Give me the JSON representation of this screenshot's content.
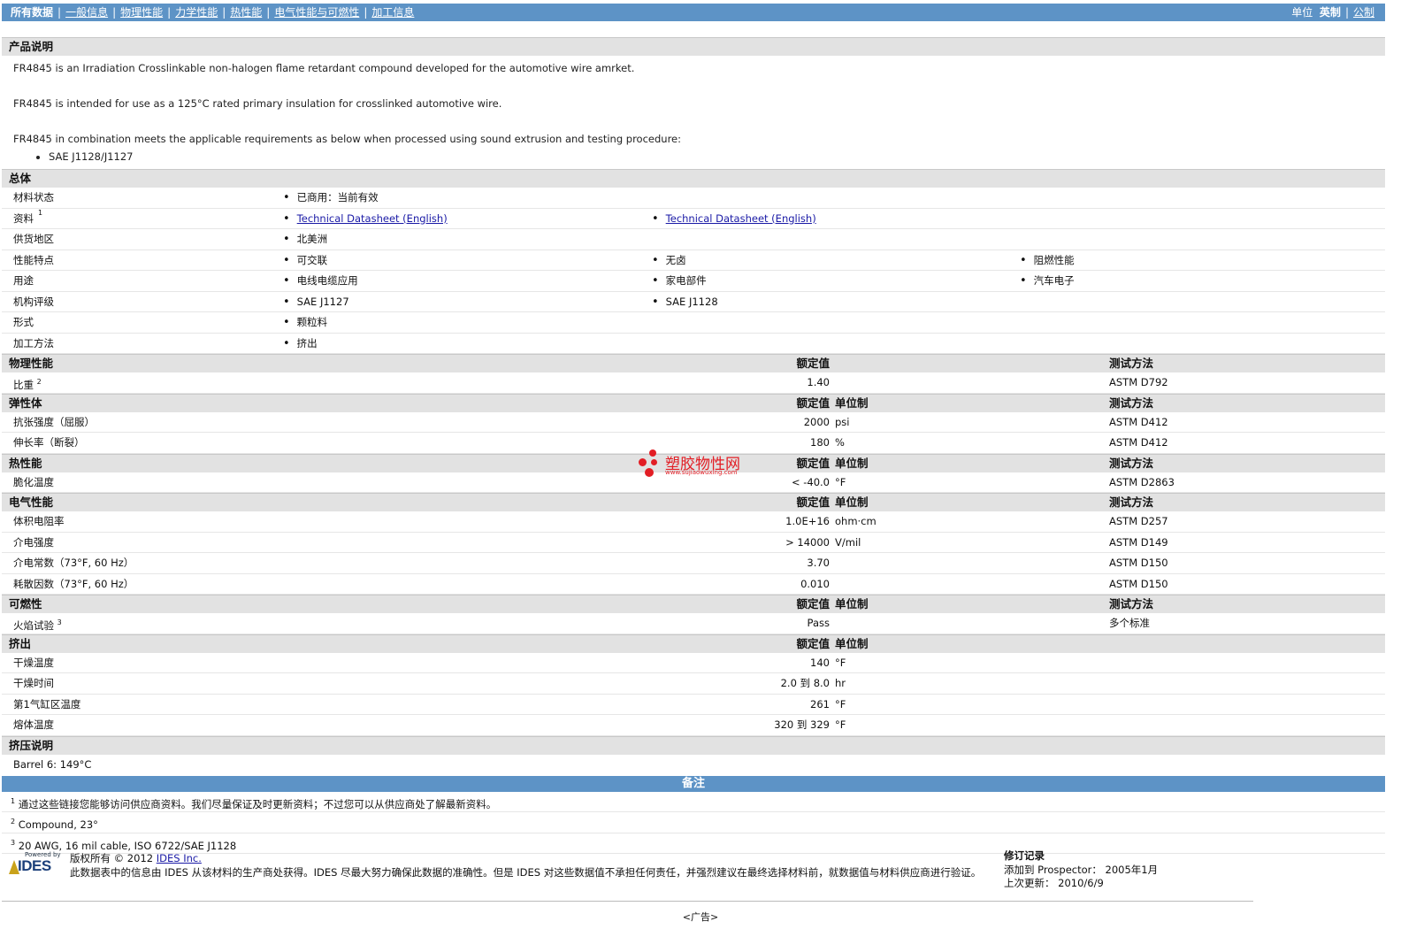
{
  "nav": {
    "items": [
      "所有数据",
      "一般信息",
      "物理性能",
      "力学性能",
      "热性能",
      "电气性能与可燃性",
      "加工信息"
    ],
    "units_label": "单位",
    "unit_english": "英制",
    "unit_metric": "公制"
  },
  "description": {
    "title": "产品说明",
    "p1": "FR4845 is an Irradiation Crosslinkable non-halogen flame retardant compound developed for the automotive wire amrket.",
    "p2": "FR4845 is intended for use as a 125°C rated primary insulation for crosslinked automotive wire.",
    "p3": "FR4845 in combination meets the applicable requirements as below when processed using sound extrusion and testing procedure:",
    "bullet": "SAE J1128/J1127"
  },
  "general": {
    "title": "总体",
    "rows": [
      {
        "label": "材料状态",
        "sup": "",
        "values": [
          "已商用：当前有效"
        ]
      },
      {
        "label": "资料",
        "sup": "1",
        "values": [
          "Technical Datasheet (English)",
          "Technical Datasheet (English)"
        ]
      },
      {
        "label": "供货地区",
        "sup": "",
        "values": [
          "北美洲"
        ]
      },
      {
        "label": "性能特点",
        "sup": "",
        "values": [
          "可交联",
          "无卤",
          "阻燃性能"
        ]
      },
      {
        "label": "用途",
        "sup": "",
        "values": [
          "电线电缆应用",
          "家电部件",
          "汽车电子"
        ]
      },
      {
        "label": "机构评级",
        "sup": "",
        "values": [
          "SAE J1127",
          "SAE J1128"
        ]
      },
      {
        "label": "形式",
        "sup": "",
        "values": [
          "颗粒料"
        ]
      },
      {
        "label": "加工方法",
        "sup": "",
        "values": [
          "挤出"
        ]
      }
    ]
  },
  "columns": {
    "nominal": "额定值",
    "unit": "单位制",
    "method": "测试方法"
  },
  "physical": {
    "title": "物理性能",
    "rows": [
      {
        "label": "比重",
        "sup": "2",
        "value": "1.40",
        "unit": "",
        "method": "ASTM D792"
      }
    ]
  },
  "elastomer": {
    "title": "弹性体",
    "rows": [
      {
        "label": "抗张强度（屈服）",
        "sup": "",
        "value": "2000",
        "unit": "psi",
        "method": "ASTM D412"
      },
      {
        "label": "伸长率（断裂）",
        "sup": "",
        "value": "180",
        "unit": "%",
        "method": "ASTM D412"
      }
    ]
  },
  "thermal": {
    "title": "热性能",
    "rows": [
      {
        "label": "脆化温度",
        "sup": "",
        "value": "< -40.0",
        "unit": "°F",
        "method": "ASTM D2863"
      }
    ]
  },
  "electrical": {
    "title": "电气性能",
    "rows": [
      {
        "label": "体积电阻率",
        "sup": "",
        "value": "1.0E+16",
        "unit": "ohm·cm",
        "method": "ASTM D257"
      },
      {
        "label": "介电强度",
        "sup": "",
        "value": "> 14000",
        "unit": "V/mil",
        "method": "ASTM D149"
      },
      {
        "label": "介电常数（73°F, 60 Hz）",
        "sup": "",
        "value": "3.70",
        "unit": "",
        "method": "ASTM D150"
      },
      {
        "label": "耗散因数（73°F, 60 Hz）",
        "sup": "",
        "value": "0.010",
        "unit": "",
        "method": "ASTM D150"
      }
    ]
  },
  "flammability": {
    "title": "可燃性",
    "rows": [
      {
        "label": "火焰试验",
        "sup": "3",
        "value": "Pass",
        "unit": "",
        "method": "多个标准"
      }
    ]
  },
  "extrusion": {
    "title": "挤出",
    "rows": [
      {
        "label": "干燥温度",
        "sup": "",
        "value": "140",
        "unit": "°F",
        "method": ""
      },
      {
        "label": "干燥时间",
        "sup": "",
        "value": "2.0 到  8.0",
        "unit": "hr",
        "method": ""
      },
      {
        "label": "第1气缸区温度",
        "sup": "",
        "value": "261",
        "unit": "°F",
        "method": ""
      },
      {
        "label": "熔体温度",
        "sup": "",
        "value": "320 到  329",
        "unit": "°F",
        "method": ""
      }
    ]
  },
  "extrusion_notes": {
    "title": "挤压说明",
    "text": "Barrel 6: 149°C"
  },
  "notes": {
    "title": "备注",
    "items": [
      {
        "sup": "1",
        "text": "通过这些链接您能够访问供应商资料。我们尽量保证及时更新资料；不过您可以从供应商处了解最新资料。"
      },
      {
        "sup": "2",
        "text": "Compound, 23°"
      },
      {
        "sup": "3",
        "text": "20 AWG, 16 mil cable, ISO 6722/SAE J1128"
      }
    ]
  },
  "footer": {
    "powered_by": "Powered by",
    "logo_text": "IDES",
    "copyright": "版权所有 © 2012",
    "company_link": "IDES Inc.",
    "disclaimer": "此数据表中的信息由 IDES 从该材料的生产商处获得。IDES 尽最大努力确保此数据的准确性。但是 IDES 对这些数据值不承担任何责任，并强烈建议在最终选择材料前，就数据值与材料供应商进行验证。",
    "revision_title": "修订记录",
    "added_label": "添加到 Prospector：",
    "added_value": "2005年1月",
    "updated_label": "上次更新：",
    "updated_value": "2010/6/9"
  },
  "ad": "<广告>",
  "watermark": {
    "text": "塑胶物性网",
    "url": "www.sujiaowuxing.com",
    "color": "#e21d24"
  }
}
